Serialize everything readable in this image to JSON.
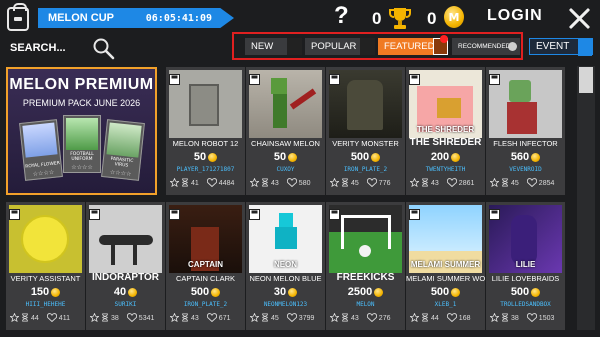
{
  "header": {
    "event_name": "MELON CUP",
    "timer": "06:05:41:09",
    "help_label": "?",
    "trophies": "0",
    "coins": "0",
    "coin_glyph": "M",
    "login_label": "LOGIN"
  },
  "search": {
    "label": "SEARCH..."
  },
  "filters": [
    {
      "label": "NEW",
      "active": false
    },
    {
      "label": "POPULAR",
      "active": false
    },
    {
      "label": "FEATURED",
      "active": true
    },
    {
      "label": "RECOMMENDED",
      "active": false
    },
    {
      "label": "EVENT",
      "active": false
    }
  ],
  "premium": {
    "title": "MELON PREMIUM",
    "subtitle": "PREMIUM PACK JUNE 2026",
    "packs": [
      {
        "caption": "ROYAL FLOWER",
        "stars": "☆☆☆☆"
      },
      {
        "caption": "FOOTBALL UNIFORM",
        "stars": "☆☆☆☆"
      },
      {
        "caption": "PARASITIC VIRUS",
        "stars": "☆☆☆☆"
      }
    ]
  },
  "items": [
    {
      "name": "MELON ROBOT 12",
      "price": "50",
      "author": "PLAYER_171271807",
      "likes": "41",
      "downloads": "4484",
      "thumb": "robot"
    },
    {
      "name": "CHAINSAW MELON",
      "price": "50",
      "author": "CUXOY",
      "likes": "43",
      "downloads": "580",
      "thumb": "chainsaw"
    },
    {
      "name": "VERITY MONSTER",
      "price": "500",
      "author": "IRON_PLATE_2",
      "likes": "45",
      "downloads": "776",
      "thumb": "monster"
    },
    {
      "name": "THE SHREDER",
      "price": "200",
      "author": "TWENTYHEITH",
      "likes": "43",
      "downloads": "2861",
      "thumb": "shreder",
      "thumb_text": "THE SHREDER"
    },
    {
      "name": "FLESH INFECTOR",
      "price": "560",
      "author": "VEVENROID",
      "likes": "45",
      "downloads": "2854",
      "thumb": "flesh"
    },
    {
      "name": "VERITY ASSISTANT",
      "price": "150",
      "author": "HIII_HEHEHE",
      "likes": "44",
      "downloads": "411",
      "thumb": "assistant"
    },
    {
      "name": "INDORAPTOR",
      "price": "40",
      "author": "SURIKI",
      "likes": "38",
      "downloads": "5341",
      "thumb": "raptor"
    },
    {
      "name": "CAPTAIN CLARK",
      "price": "500",
      "author": "IRON_PLATE_2",
      "likes": "43",
      "downloads": "671",
      "thumb": "captain",
      "thumb_text": "CAPTAIN"
    },
    {
      "name": "NEON MELON BLUE",
      "price": "30",
      "author": "NEONMELON123",
      "likes": "45",
      "downloads": "3799",
      "thumb": "neon",
      "thumb_text": "NEON"
    },
    {
      "name": "FREEKICKS",
      "price": "2500",
      "author": "MELON",
      "likes": "43",
      "downloads": "276",
      "thumb": "freekicks"
    },
    {
      "name": "MELAMI SUMMER WORLD",
      "price": "500",
      "author": "XLEB_1",
      "likes": "44",
      "downloads": "168",
      "thumb": "summer",
      "thumb_text": "MELAMI SUMMER"
    },
    {
      "name": "LILIE LOVEBRAIDS",
      "price": "500",
      "author": "TROLLEDSANDBOX",
      "likes": "38",
      "downloads": "1503",
      "thumb": "lilie",
      "thumb_text": "LILIE"
    }
  ],
  "colors": {
    "accent": "#1e88e5",
    "featured": "#f07a23",
    "highlight_box": "#e02020",
    "premium_border": "#f2a12a",
    "author": "#4bc0ff"
  }
}
